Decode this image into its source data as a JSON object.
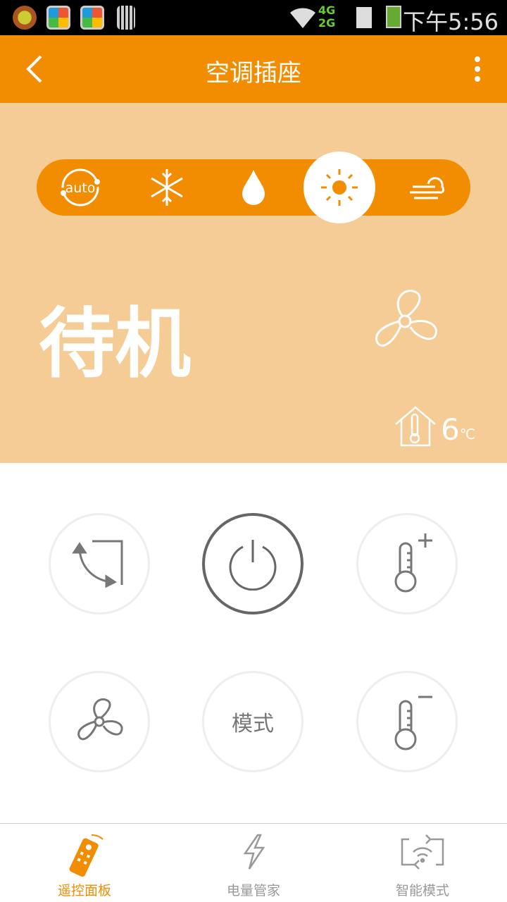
{
  "status_bar": {
    "time": "下午5:56",
    "network": "4G 2G",
    "icons": [
      "phone-app-icon",
      "app-store-icon",
      "app-store-icon",
      "barcode-icon",
      "wifi-icon",
      "signal-icon",
      "sim-icon",
      "battery-icon"
    ]
  },
  "header": {
    "title": "空调插座"
  },
  "modes": [
    {
      "name": "auto",
      "label": "auto"
    },
    {
      "name": "cool"
    },
    {
      "name": "dry"
    },
    {
      "name": "heat",
      "selected": true
    },
    {
      "name": "fan"
    }
  ],
  "state": "待机",
  "indoor_temp": {
    "value": "6",
    "unit": "℃"
  },
  "controls": {
    "mode_label": "模式"
  },
  "tabs": [
    {
      "label": "遥控面板",
      "active": true
    },
    {
      "label": "电量管家"
    },
    {
      "label": "智能模式"
    }
  ],
  "colors": {
    "accent": "#f28c00",
    "panel": "#f5cb96"
  }
}
